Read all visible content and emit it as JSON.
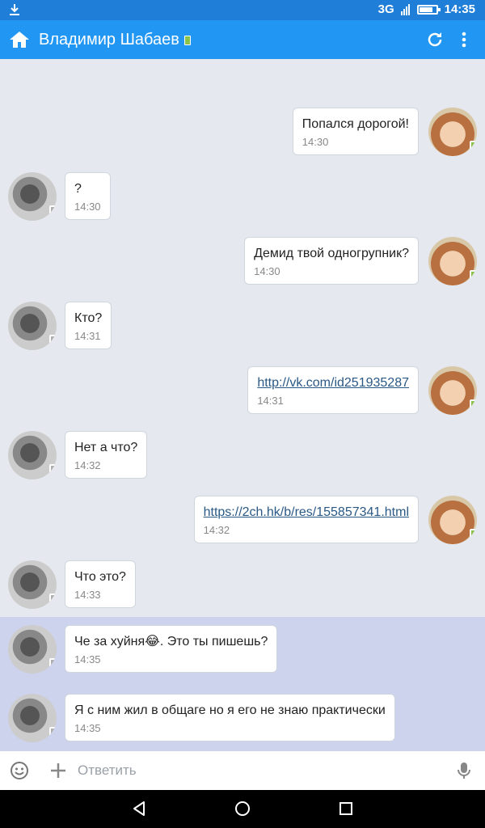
{
  "status_bar": {
    "network": "3G",
    "time": "14:35",
    "battery_level": 0.8
  },
  "app_bar": {
    "title": "Владимир Шабаев"
  },
  "messages": [
    {
      "from": "me",
      "text": "Попался дорогой!",
      "time": "14:30",
      "link": false
    },
    {
      "from": "him",
      "text": "?",
      "time": "14:30",
      "link": false
    },
    {
      "from": "me",
      "text": "Демид твой одногрупник?",
      "time": "14:30",
      "link": false
    },
    {
      "from": "him",
      "text": "Кто?",
      "time": "14:31",
      "link": false
    },
    {
      "from": "me",
      "text": "http://vk.com/id251935287",
      "time": "14:31",
      "link": true
    },
    {
      "from": "him",
      "text": "Нет а что?",
      "time": "14:32",
      "link": false
    },
    {
      "from": "me",
      "text": "https://2ch.hk/b/res/155857341.html",
      "time": "14:32",
      "link": true
    },
    {
      "from": "him",
      "text": "Что это?",
      "time": "14:33",
      "link": false
    },
    {
      "from": "him",
      "text": "Че за хуйня😂. Это ты пишешь?",
      "time": "14:35",
      "link": false,
      "unread": true
    },
    {
      "from": "him",
      "text": "Я с ним жил в общаге но я его не знаю практически",
      "time": "14:35",
      "link": false,
      "unread": true
    }
  ],
  "composer": {
    "placeholder": "Ответить"
  },
  "colors": {
    "app_bar": "#2196f3",
    "status_bar": "#1e7ed8",
    "background": "#e5e9ef",
    "unread_bg": "#cdd3ec",
    "link": "#2a5885",
    "online_badge": "#8bc34a"
  }
}
